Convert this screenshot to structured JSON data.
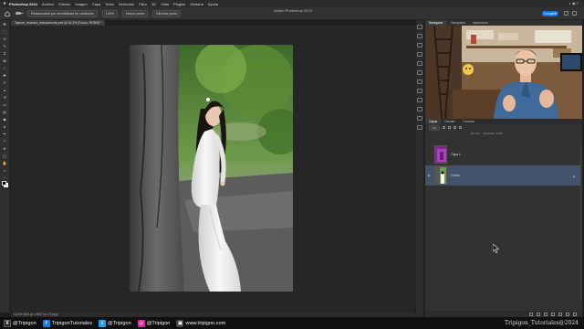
{
  "menubar": {
    "app": "Photoshop 2024",
    "menus": [
      "Archivo",
      "Edición",
      "Imagen",
      "Capa",
      "Texto",
      "Selección",
      "Filtro",
      "3D",
      "Vista",
      "Plugins",
      "Ventana",
      "Ayuda"
    ]
  },
  "window_title": "Adobe Photoshop 2024",
  "options": {
    "btn1": "Restauración por sensibilidad de contenido",
    "btn2": "100%",
    "btn3": "Nuevo punto",
    "btn4": "Eliminar punto"
  },
  "share_label": "Compartir",
  "doc_tab": "Tapizar_muestra_naturalmente.psd @ 16,3% (Fondo, RGB/8) *",
  "status_bar": "16,3%   4025 px x 6037 px (72 ppp)",
  "panel_tabs": [
    "Navegador",
    "Histograma",
    "Información"
  ],
  "layers_tabs": [
    "Capas",
    "Canales",
    "Trazados"
  ],
  "layers_filter": {
    "kind": "Tipo",
    "blend": "Normal",
    "opacity": "Opacidad: 100%"
  },
  "layers": [
    {
      "name": "Capa 1"
    },
    {
      "name": "Fondo"
    }
  ],
  "social": {
    "x": "@Tripigon",
    "facebook": "TripigonTutoriales",
    "twitter": "@Tripigon",
    "instagram": "@Tripigon",
    "web": "www.tripigon.com",
    "brand": "Tripigon_Tutoriales@2024"
  },
  "colors": {
    "accent": "#1473e6",
    "selected_layer": "#44536b",
    "panel_bg": "#323232"
  }
}
